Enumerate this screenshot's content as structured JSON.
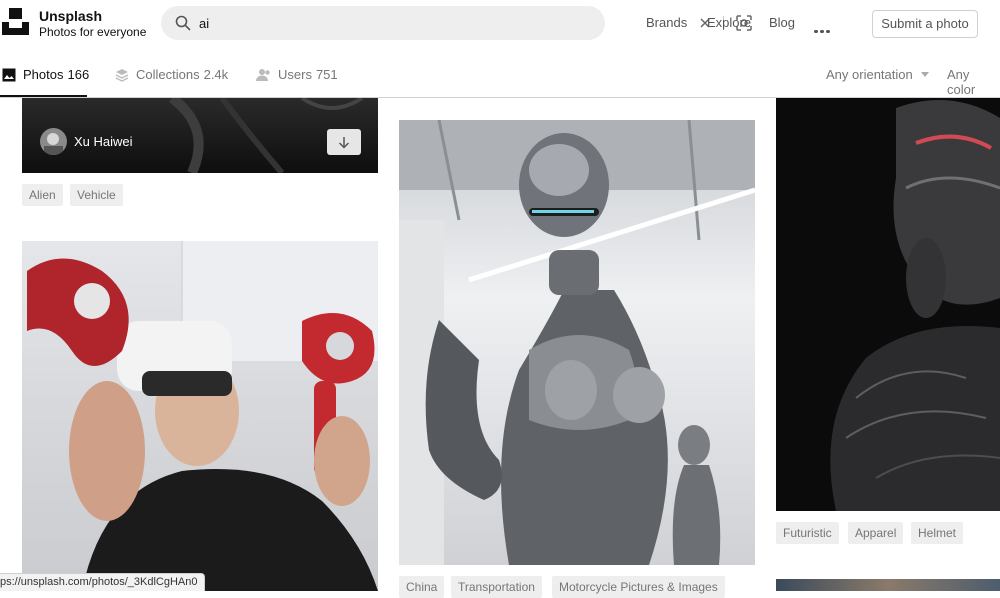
{
  "header": {
    "brand_name": "Unsplash",
    "brand_tagline": "Photos for everyone",
    "search_value": "ai",
    "nav": [
      "Brands",
      "Explore",
      "Blog"
    ],
    "submit_label": "Submit a photo"
  },
  "tabs": [
    {
      "label": "Photos",
      "count": "166"
    },
    {
      "label": "Collections",
      "count": "2.4k"
    },
    {
      "label": "Users",
      "count": "751"
    }
  ],
  "filters": {
    "orientation": "Any orientation",
    "color": "Any color"
  },
  "columns": {
    "left": {
      "author": "Xu Haiwei",
      "tags_top": [
        "Alien",
        "Vehicle"
      ]
    },
    "middle": {
      "tags": [
        "China",
        "Transportation",
        "Motorcycle Pictures & Images"
      ]
    },
    "right": {
      "tags": [
        "Futuristic",
        "Apparel",
        "Helmet"
      ]
    }
  },
  "status_bar_url": "ps://unsplash.com/photos/_3KdlCgHAn0",
  "icons": {
    "search": "search-icon",
    "clear": "close-icon",
    "visual_search": "visual-search-icon",
    "more": "more-horizontal-icon",
    "photos": "image-icon",
    "collections": "stack-icon",
    "users": "users-icon",
    "download": "download-icon"
  }
}
